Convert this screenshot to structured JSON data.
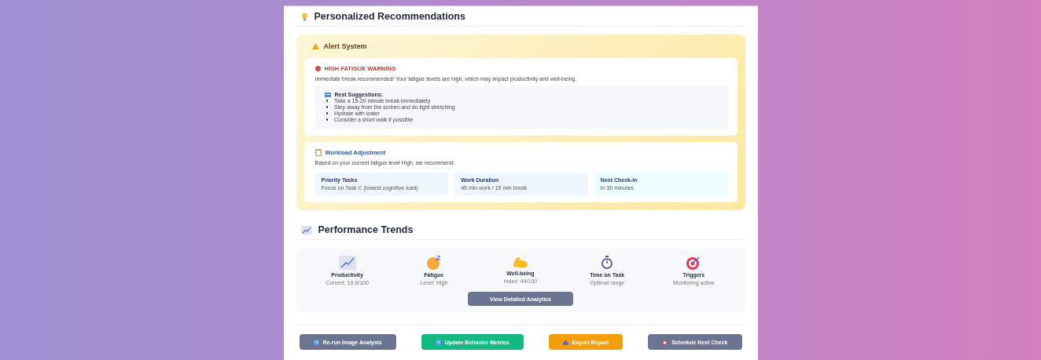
{
  "section_title": "Personalized Recommendations",
  "alert": {
    "title": "Alert System",
    "warning": {
      "title": "HIGH FATIGUE WARNING",
      "message": "Immediate break recommended! Your fatigue levels are high, which may impact productivity and well-being.",
      "suggestions_title": "Rest Suggestions:",
      "suggestions": [
        "Take a 15-20 minute break immediately",
        "Step away from the screen and do light stretching",
        "Hydrate with water",
        "Consider a short walk if possible"
      ]
    },
    "workload": {
      "title": "Workload Adjustment",
      "intro": "Based on your current fatigue level High, we recommend:",
      "tiles": [
        {
          "label": "Priority Tasks",
          "value": "Focus on Task C (lowest cognitive load)",
          "color": "#eff6ff"
        },
        {
          "label": "Work Duration",
          "value": "45 min work / 15 min break",
          "color": "#eff6ff"
        },
        {
          "label": "Next Check-in",
          "value": "In 30 minutes",
          "color": "#ecfeff"
        }
      ]
    }
  },
  "trends": {
    "title": "Performance Trends",
    "items": [
      {
        "kind": "chart",
        "label": "Productivity",
        "detail": "Current: 19.9/100"
      },
      {
        "kind": "sleepy",
        "label": "Fatigue",
        "detail": "Level: High"
      },
      {
        "kind": "muscle",
        "label": "Well-being",
        "detail": "Index: 44/100"
      },
      {
        "kind": "stopwatch",
        "label": "Time on Task",
        "detail": "Optimal range"
      },
      {
        "kind": "target",
        "label": "Triggers",
        "detail": "Monitoring active"
      }
    ],
    "button": "View Detailed Analytics"
  },
  "actions": [
    {
      "kind": "refresh",
      "label": "Re-run Image Analysis",
      "color": "#6b7591"
    },
    {
      "kind": "refresh",
      "label": "Update Behavior Metrics",
      "color": "#12b981"
    },
    {
      "kind": "export",
      "label": "Export Report",
      "color": "#f59e0b"
    },
    {
      "kind": "alarm",
      "label": "Schedule Next Check",
      "color": "#6b7591"
    }
  ]
}
